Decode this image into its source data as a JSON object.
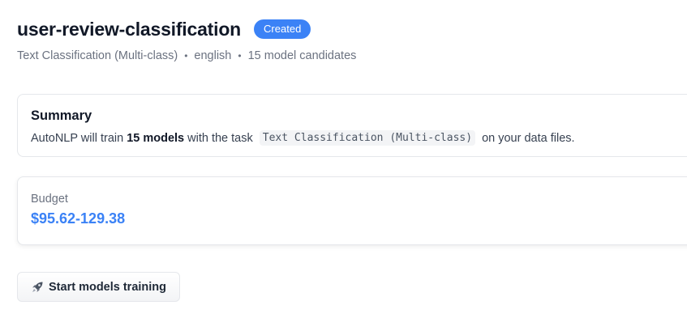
{
  "header": {
    "title": "user-review-classification",
    "status_badge": "Created"
  },
  "meta": {
    "task": "Text Classification (Multi-class)",
    "language": "english",
    "candidates": "15 model candidates",
    "separator": "•"
  },
  "summary": {
    "title": "Summary",
    "text_prefix": "AutoNLP will train ",
    "model_count": "15 models",
    "text_middle": " with the task ",
    "task_code": "Text Classification (Multi-class)",
    "text_suffix": " on your data files."
  },
  "budget": {
    "label": "Budget",
    "value": "$95.62-129.38"
  },
  "actions": {
    "start_training_label": "Start models training",
    "start_training_icon": "rocket-icon"
  },
  "colors": {
    "accent": "#3b82f6",
    "muted_text": "#6b7280",
    "border": "#e5e7eb"
  }
}
